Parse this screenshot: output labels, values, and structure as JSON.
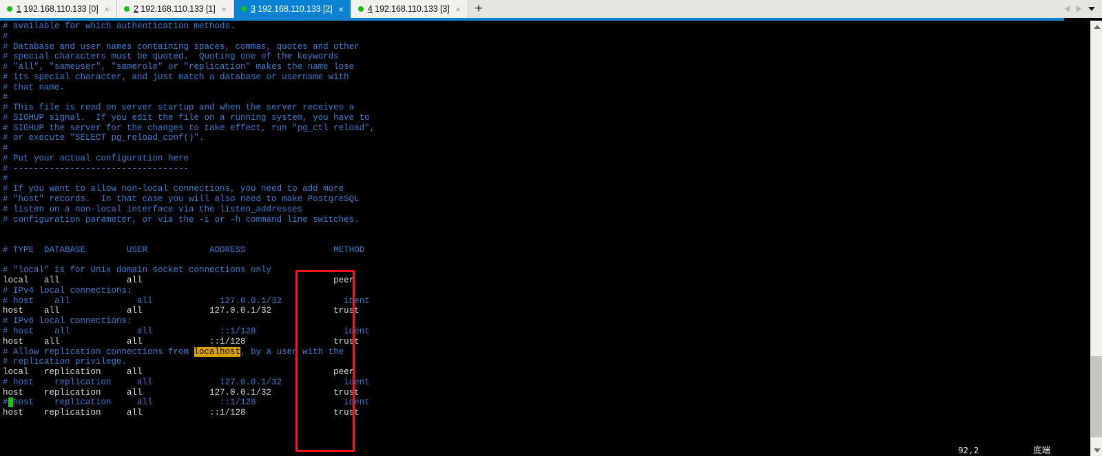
{
  "window": {
    "tabbar": {
      "tabs": [
        {
          "num": "1",
          "title": " 192.168.110.133 [0]",
          "active": false,
          "status_dot": "connected-dot",
          "close": "×"
        },
        {
          "num": "2",
          "title": " 192.168.110.133 [1]",
          "active": false,
          "status_dot": "connected-dot",
          "close": "×"
        },
        {
          "num": "3",
          "title": " 192.168.110.133 [2]",
          "active": true,
          "status_dot": "connected-dot",
          "close": "×"
        },
        {
          "num": "4",
          "title": " 192.168.110.133 [3]",
          "active": false,
          "status_dot": "connected-dot",
          "close": "×"
        }
      ],
      "new_tab_label": "+",
      "nav_prev_icon": "triangle-left-icon",
      "nav_next_icon": "triangle-right-icon",
      "nav_menu_icon": "chevron-down-icon"
    },
    "scrollbar": {
      "up_icon": "scroll-up-arrow-icon",
      "down_icon": "scroll-down-arrow-icon"
    }
  },
  "editor": {
    "lines": [
      [
        {
          "t": "# available for which authentication methods.",
          "c": "cm"
        }
      ],
      [
        {
          "t": "#",
          "c": "cm"
        }
      ],
      [
        {
          "t": "# Database and user names containing spaces, commas, quotes and other",
          "c": "cm"
        }
      ],
      [
        {
          "t": "# special characters must be quoted.  Quoting one of the keywords",
          "c": "cm"
        }
      ],
      [
        {
          "t": "# \"all\", \"sameuser\", \"samerole\" or \"replication\" makes the name lose",
          "c": "cm"
        }
      ],
      [
        {
          "t": "# its special character, and just match a database or username with",
          "c": "cm"
        }
      ],
      [
        {
          "t": "# that name.",
          "c": "cm"
        }
      ],
      [
        {
          "t": "#",
          "c": "cm"
        }
      ],
      [
        {
          "t": "# This file is read on server startup and when the server receives a",
          "c": "cm"
        }
      ],
      [
        {
          "t": "# SIGHUP signal.  If you edit the file on a running system, you have to",
          "c": "cm"
        }
      ],
      [
        {
          "t": "# SIGHUP the server for the changes to take effect, run \"pg_ctl reload\",",
          "c": "cm"
        }
      ],
      [
        {
          "t": "# or execute \"SELECT pg_reload_conf()\".",
          "c": "cm"
        }
      ],
      [
        {
          "t": "#",
          "c": "cm"
        }
      ],
      [
        {
          "t": "# Put your actual configuration here",
          "c": "cm"
        }
      ],
      [
        {
          "t": "# ----------------------------------",
          "c": "cm"
        }
      ],
      [
        {
          "t": "#",
          "c": "cm"
        }
      ],
      [
        {
          "t": "# If you want to allow non-local connections, you need to add more",
          "c": "cm"
        }
      ],
      [
        {
          "t": "# \"host\" records.  In that case you will also need to make PostgreSQL",
          "c": "cm"
        }
      ],
      [
        {
          "t": "# listen on a non-local interface via the listen_addresses",
          "c": "cm"
        }
      ],
      [
        {
          "t": "# configuration parameter, or via the -i or -h command line switches.",
          "c": "cm"
        }
      ],
      [
        {
          "t": "",
          "c": "cm"
        }
      ],
      [
        {
          "t": "",
          "c": "cm"
        }
      ],
      [
        {
          "t": "# TYPE  DATABASE        USER            ADDRESS                 METHOD",
          "c": "cm"
        }
      ],
      [
        {
          "t": "",
          "c": "cm"
        }
      ],
      [
        {
          "t": "# \"local\" is for Unix domain socket connections only",
          "c": "cm"
        }
      ],
      [
        {
          "t": "local   all             all                                     peer",
          "c": "pl"
        }
      ],
      [
        {
          "t": "# IPv4 local connections:",
          "c": "cm"
        }
      ],
      [
        {
          "t": "# host    all             all             127.0.0.1/32            ident",
          "c": "cm"
        }
      ],
      [
        {
          "t": "host    all             all             127.0.0.1/32            trust",
          "c": "pl"
        }
      ],
      [
        {
          "t": "# IPv6 local connections:",
          "c": "cm"
        }
      ],
      [
        {
          "t": "# host    all             all             ::1/128                 ident",
          "c": "cm"
        }
      ],
      [
        {
          "t": "host    all             all             ::1/128                 trust",
          "c": "pl"
        }
      ],
      [
        {
          "t": "# Allow replication connections from ",
          "c": "cm"
        },
        {
          "t": "localhost",
          "c": "hl"
        },
        {
          "t": ", by a user with the",
          "c": "cm"
        }
      ],
      [
        {
          "t": "# replication privilege.",
          "c": "cm"
        }
      ],
      [
        {
          "t": "local   replication     all                                     peer",
          "c": "pl"
        }
      ],
      [
        {
          "t": "# host    replication     all             127.0.0.1/32            ident",
          "c": "cm"
        }
      ],
      [
        {
          "t": "host    replication     all             127.0.0.1/32            trust",
          "c": "pl"
        }
      ],
      [
        {
          "t": "#",
          "c": "cm"
        },
        {
          "t": " ",
          "c": "cur"
        },
        {
          "t": "host    replication     all             ::1/128                 ident",
          "c": "cm"
        }
      ],
      [
        {
          "t": "host    replication     all             ::1/128                 trust",
          "c": "pl"
        }
      ]
    ],
    "status": {
      "cursor_position": "92,2",
      "file_state": "底端"
    },
    "annotation": {
      "type": "red-rectangle",
      "color": "#fb1414",
      "highlights_column": "METHOD"
    },
    "search_match": "localhost",
    "search_match_color": "#d9a200"
  }
}
